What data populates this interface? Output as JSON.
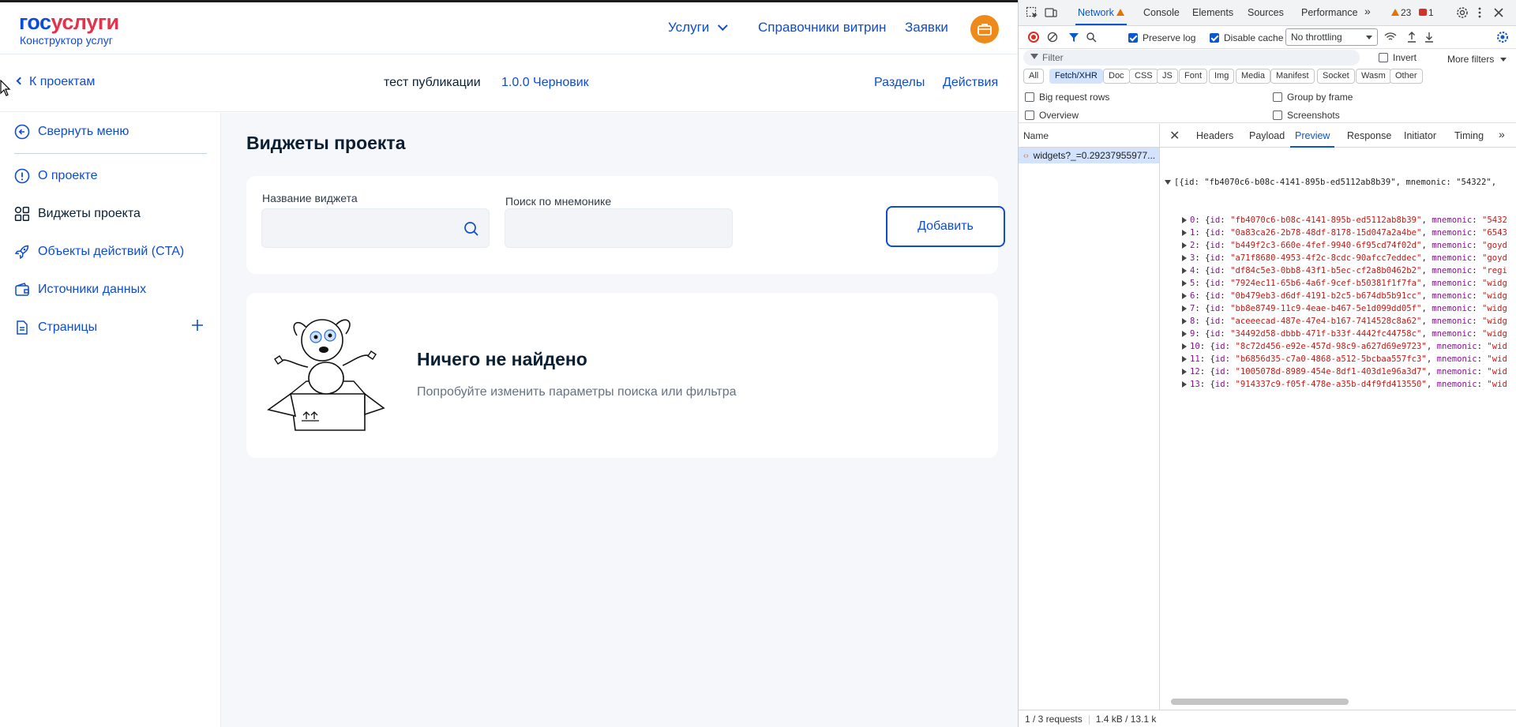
{
  "app": {
    "logo": {
      "part1": "гос",
      "part2": "услуги",
      "subtitle": "Конструктор услуг"
    },
    "topnav": {
      "services": "Услуги",
      "refs": "Справочники витрин",
      "orders": "Заявки"
    },
    "subbar": {
      "back": "К проектам",
      "project_name": "тест публикации",
      "version": "1.0.0 Черновик",
      "sections": "Разделы",
      "actions": "Действия"
    },
    "sidebar": {
      "items": [
        {
          "label": "Свернуть меню",
          "icon": "arrow-circle-left-icon"
        },
        {
          "label": "О проекте",
          "icon": "info-circle-icon"
        },
        {
          "label": "Виджеты проекта",
          "icon": "grid-icon"
        },
        {
          "label": "Объекты действий (CTA)",
          "icon": "rocket-icon"
        },
        {
          "label": "Источники данных",
          "icon": "wallet-icon"
        },
        {
          "label": "Страницы",
          "icon": "document-icon"
        }
      ]
    },
    "main": {
      "title": "Виджеты проекта",
      "widget_name_label": "Название виджета",
      "widget_name_value": "",
      "mnemonic_label": "Поиск по мнемонике",
      "mnemonic_value": "",
      "add_button": "Добавить",
      "empty_title": "Ничего не найдено",
      "empty_text": "Попробуйте изменить параметры поиска или фильтра"
    }
  },
  "devtools": {
    "tabs": [
      "Network",
      "Console",
      "Elements",
      "Sources",
      "Performance"
    ],
    "active_tab": "Network",
    "warnings": "23",
    "errors": "1",
    "preserve_log": "Preserve log",
    "disable_cache": "Disable cache",
    "throttling": "No throttling",
    "filter_placeholder": "Filter",
    "invert": "Invert",
    "more_filters": "More filters",
    "chips": [
      "All",
      "Fetch/XHR",
      "Doc",
      "CSS",
      "JS",
      "Font",
      "Img",
      "Media",
      "Manifest",
      "Socket",
      "Wasm",
      "Other"
    ],
    "active_chip": "Fetch/XHR",
    "options": [
      "Big request rows",
      "Group by frame",
      "Overview",
      "Screenshots"
    ],
    "list_header": "Name",
    "request": "widgets?_=0.29237955977...",
    "detail_tabs": [
      "Headers",
      "Payload",
      "Preview",
      "Response",
      "Initiator",
      "Timing"
    ],
    "active_detail_tab": "Preview",
    "json_root": "[{id: \"fb4070c6-b08c-4141-895b-ed5112ab8b39\", mnemonic: \"54322\",",
    "json_rows": [
      {
        "idx": "0",
        "id": "\"fb4070c6-b08c-4141-895b-ed5112ab8b39\"",
        "mn": "\"5432"
      },
      {
        "idx": "1",
        "id": "\"0a83ca26-2b78-48df-8178-15d047a2a4be\"",
        "mn": "\"6543"
      },
      {
        "idx": "2",
        "id": "\"b449f2c3-660e-4fef-9940-6f95cd74f02d\"",
        "mn": "\"goyd"
      },
      {
        "idx": "3",
        "id": "\"a71f8680-4953-4f2c-8cdc-90afcc7eddec\"",
        "mn": "\"goyd"
      },
      {
        "idx": "4",
        "id": "\"df84c5e3-0bb8-43f1-b5ec-cf2a8b0462b2\"",
        "mn": "\"regi"
      },
      {
        "idx": "5",
        "id": "\"7924ec11-65b6-4a6f-9cef-b50381f1f7fa\"",
        "mn": "\"widg"
      },
      {
        "idx": "6",
        "id": "\"0b479eb3-d6df-4191-b2c5-b674db5b91cc\"",
        "mn": "\"widg"
      },
      {
        "idx": "7",
        "id": "\"bb8e8749-11c9-4eae-b467-5e1d099dd05f\"",
        "mn": "\"widg"
      },
      {
        "idx": "8",
        "id": "\"aceeecad-487e-47e4-b167-7414528c8a62\"",
        "mn": "\"widg"
      },
      {
        "idx": "9",
        "id": "\"34492d58-dbbb-471f-b33f-4442fc44758c\"",
        "mn": "\"widg"
      },
      {
        "idx": "10",
        "id": "\"8c72d456-e92e-457d-98c9-a627d69e9723\"",
        "mn": "\"wid"
      },
      {
        "idx": "11",
        "id": "\"b6856d35-c7a0-4868-a512-5bcbaa557fc3\"",
        "mn": "\"wid"
      },
      {
        "idx": "12",
        "id": "\"1005078d-8989-454e-8df1-403d1e96a3d7\"",
        "mn": "\"wid"
      },
      {
        "idx": "13",
        "id": "\"914337c9-f05f-478e-a35b-d4f9fd413550\"",
        "mn": "\"wid"
      }
    ],
    "footer_requests": "1 / 3 requests",
    "footer_size": "1.4 kB / 13.1 k"
  },
  "colors": {
    "brand_blue": "#0d4cd3",
    "brand_red": "#e3324b",
    "accent_orange": "#ee8a1a",
    "devtools_blue": "#0b57d0"
  }
}
